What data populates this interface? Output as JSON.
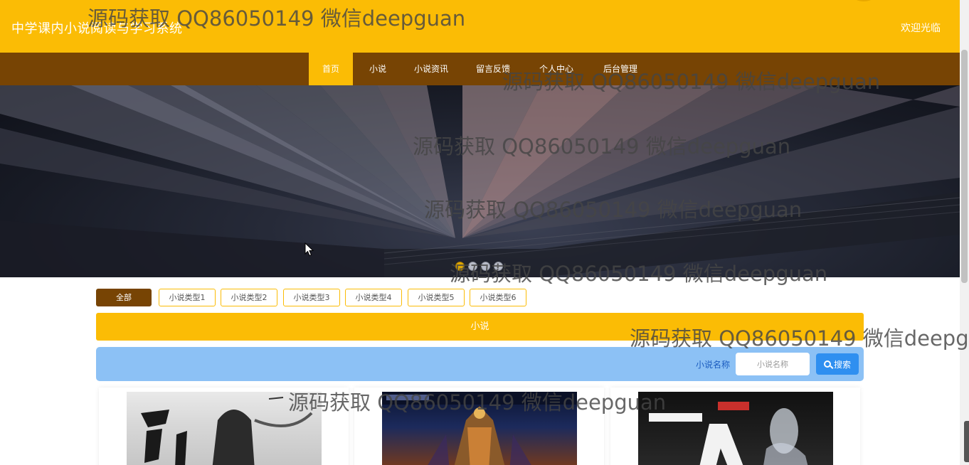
{
  "header": {
    "site_title": "中学课内小说阅读与学习系统",
    "welcome": "欢迎光临"
  },
  "nav": {
    "items": [
      {
        "label": "首页",
        "active": true
      },
      {
        "label": "小说",
        "active": false
      },
      {
        "label": "小说资讯",
        "active": false
      },
      {
        "label": "留言反馈",
        "active": false
      },
      {
        "label": "个人中心",
        "active": false
      },
      {
        "label": "后台管理",
        "active": false
      }
    ]
  },
  "banner": {
    "slides": 4,
    "active_slide": 1
  },
  "categories": [
    {
      "label": "全部",
      "active": true
    },
    {
      "label": "小说类型1",
      "active": false
    },
    {
      "label": "小说类型2",
      "active": false
    },
    {
      "label": "小说类型3",
      "active": false
    },
    {
      "label": "小说类型4",
      "active": false
    },
    {
      "label": "小说类型5",
      "active": false
    },
    {
      "label": "小说类型6",
      "active": false
    }
  ],
  "section": {
    "title": "小说"
  },
  "search": {
    "label": "小说名称",
    "placeholder": "小说名称",
    "button_label": "搜索"
  },
  "watermark": "源码获取 QQ86050149 微信deepguan",
  "colors": {
    "primary": "#fbbc05",
    "nav_bg": "#774404",
    "search_bg": "#8cc1f5",
    "search_button": "#2f8ff0"
  }
}
